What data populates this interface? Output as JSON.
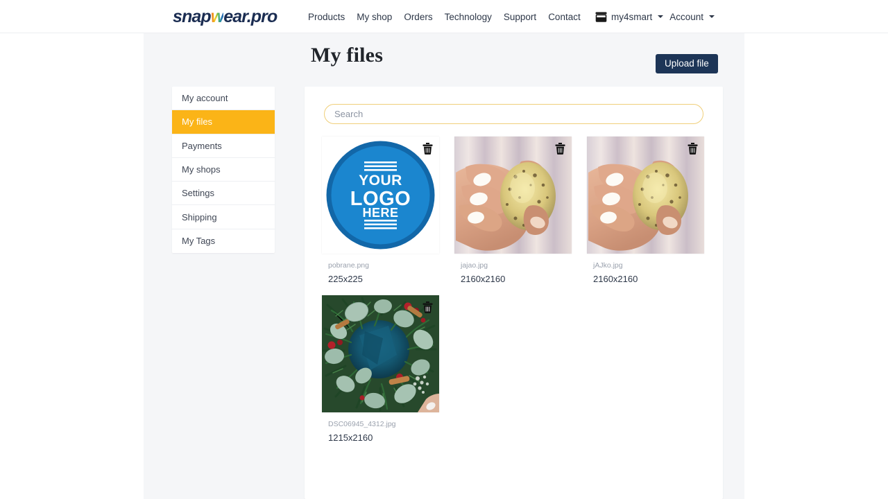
{
  "header": {
    "brand": {
      "pre": "snap",
      "accent": "w",
      "post": "ear.pro"
    },
    "nav": [
      {
        "label": "Products"
      },
      {
        "label": "My shop"
      },
      {
        "label": "Orders"
      },
      {
        "label": "Technology"
      },
      {
        "label": "Support"
      },
      {
        "label": "Contact"
      }
    ],
    "shop_selector": {
      "icon": "store-icon",
      "label": "my4smart"
    },
    "account_menu": {
      "label": "Account"
    }
  },
  "page": {
    "title": "My files",
    "upload_label": "Upload file"
  },
  "sidebar": {
    "items": [
      {
        "label": "My account",
        "active": false
      },
      {
        "label": "My files",
        "active": true
      },
      {
        "label": "Payments",
        "active": false
      },
      {
        "label": "My shops",
        "active": false
      },
      {
        "label": "Settings",
        "active": false
      },
      {
        "label": "Shipping",
        "active": false
      },
      {
        "label": "My Tags",
        "active": false
      }
    ]
  },
  "search": {
    "placeholder": "Search",
    "value": ""
  },
  "files": [
    {
      "name": "pobrane.png",
      "dimensions": "225x225",
      "thumb_kind": "logo-placeholder",
      "logo_text": [
        "YOUR",
        "LOGO",
        "HERE"
      ],
      "delete_icon": "trash-icon"
    },
    {
      "name": "jajao.jpg",
      "dimensions": "2160x2160",
      "thumb_kind": "hand-holding-egg",
      "delete_icon": "trash-icon"
    },
    {
      "name": "jAJko.jpg",
      "dimensions": "2160x2160",
      "thumb_kind": "hand-holding-egg",
      "delete_icon": "trash-icon"
    },
    {
      "name": "DSC06945_4312.jpg",
      "dimensions": "1215x2160",
      "thumb_kind": "christmas-wreath",
      "delete_icon": "trash-icon"
    }
  ],
  "colors": {
    "accent": "#fbb417",
    "brand_dark": "#1b2d52",
    "button_dark": "#1d3557",
    "page_bg": "#f5f6f8",
    "logo_blue": "#1b7dc4"
  }
}
